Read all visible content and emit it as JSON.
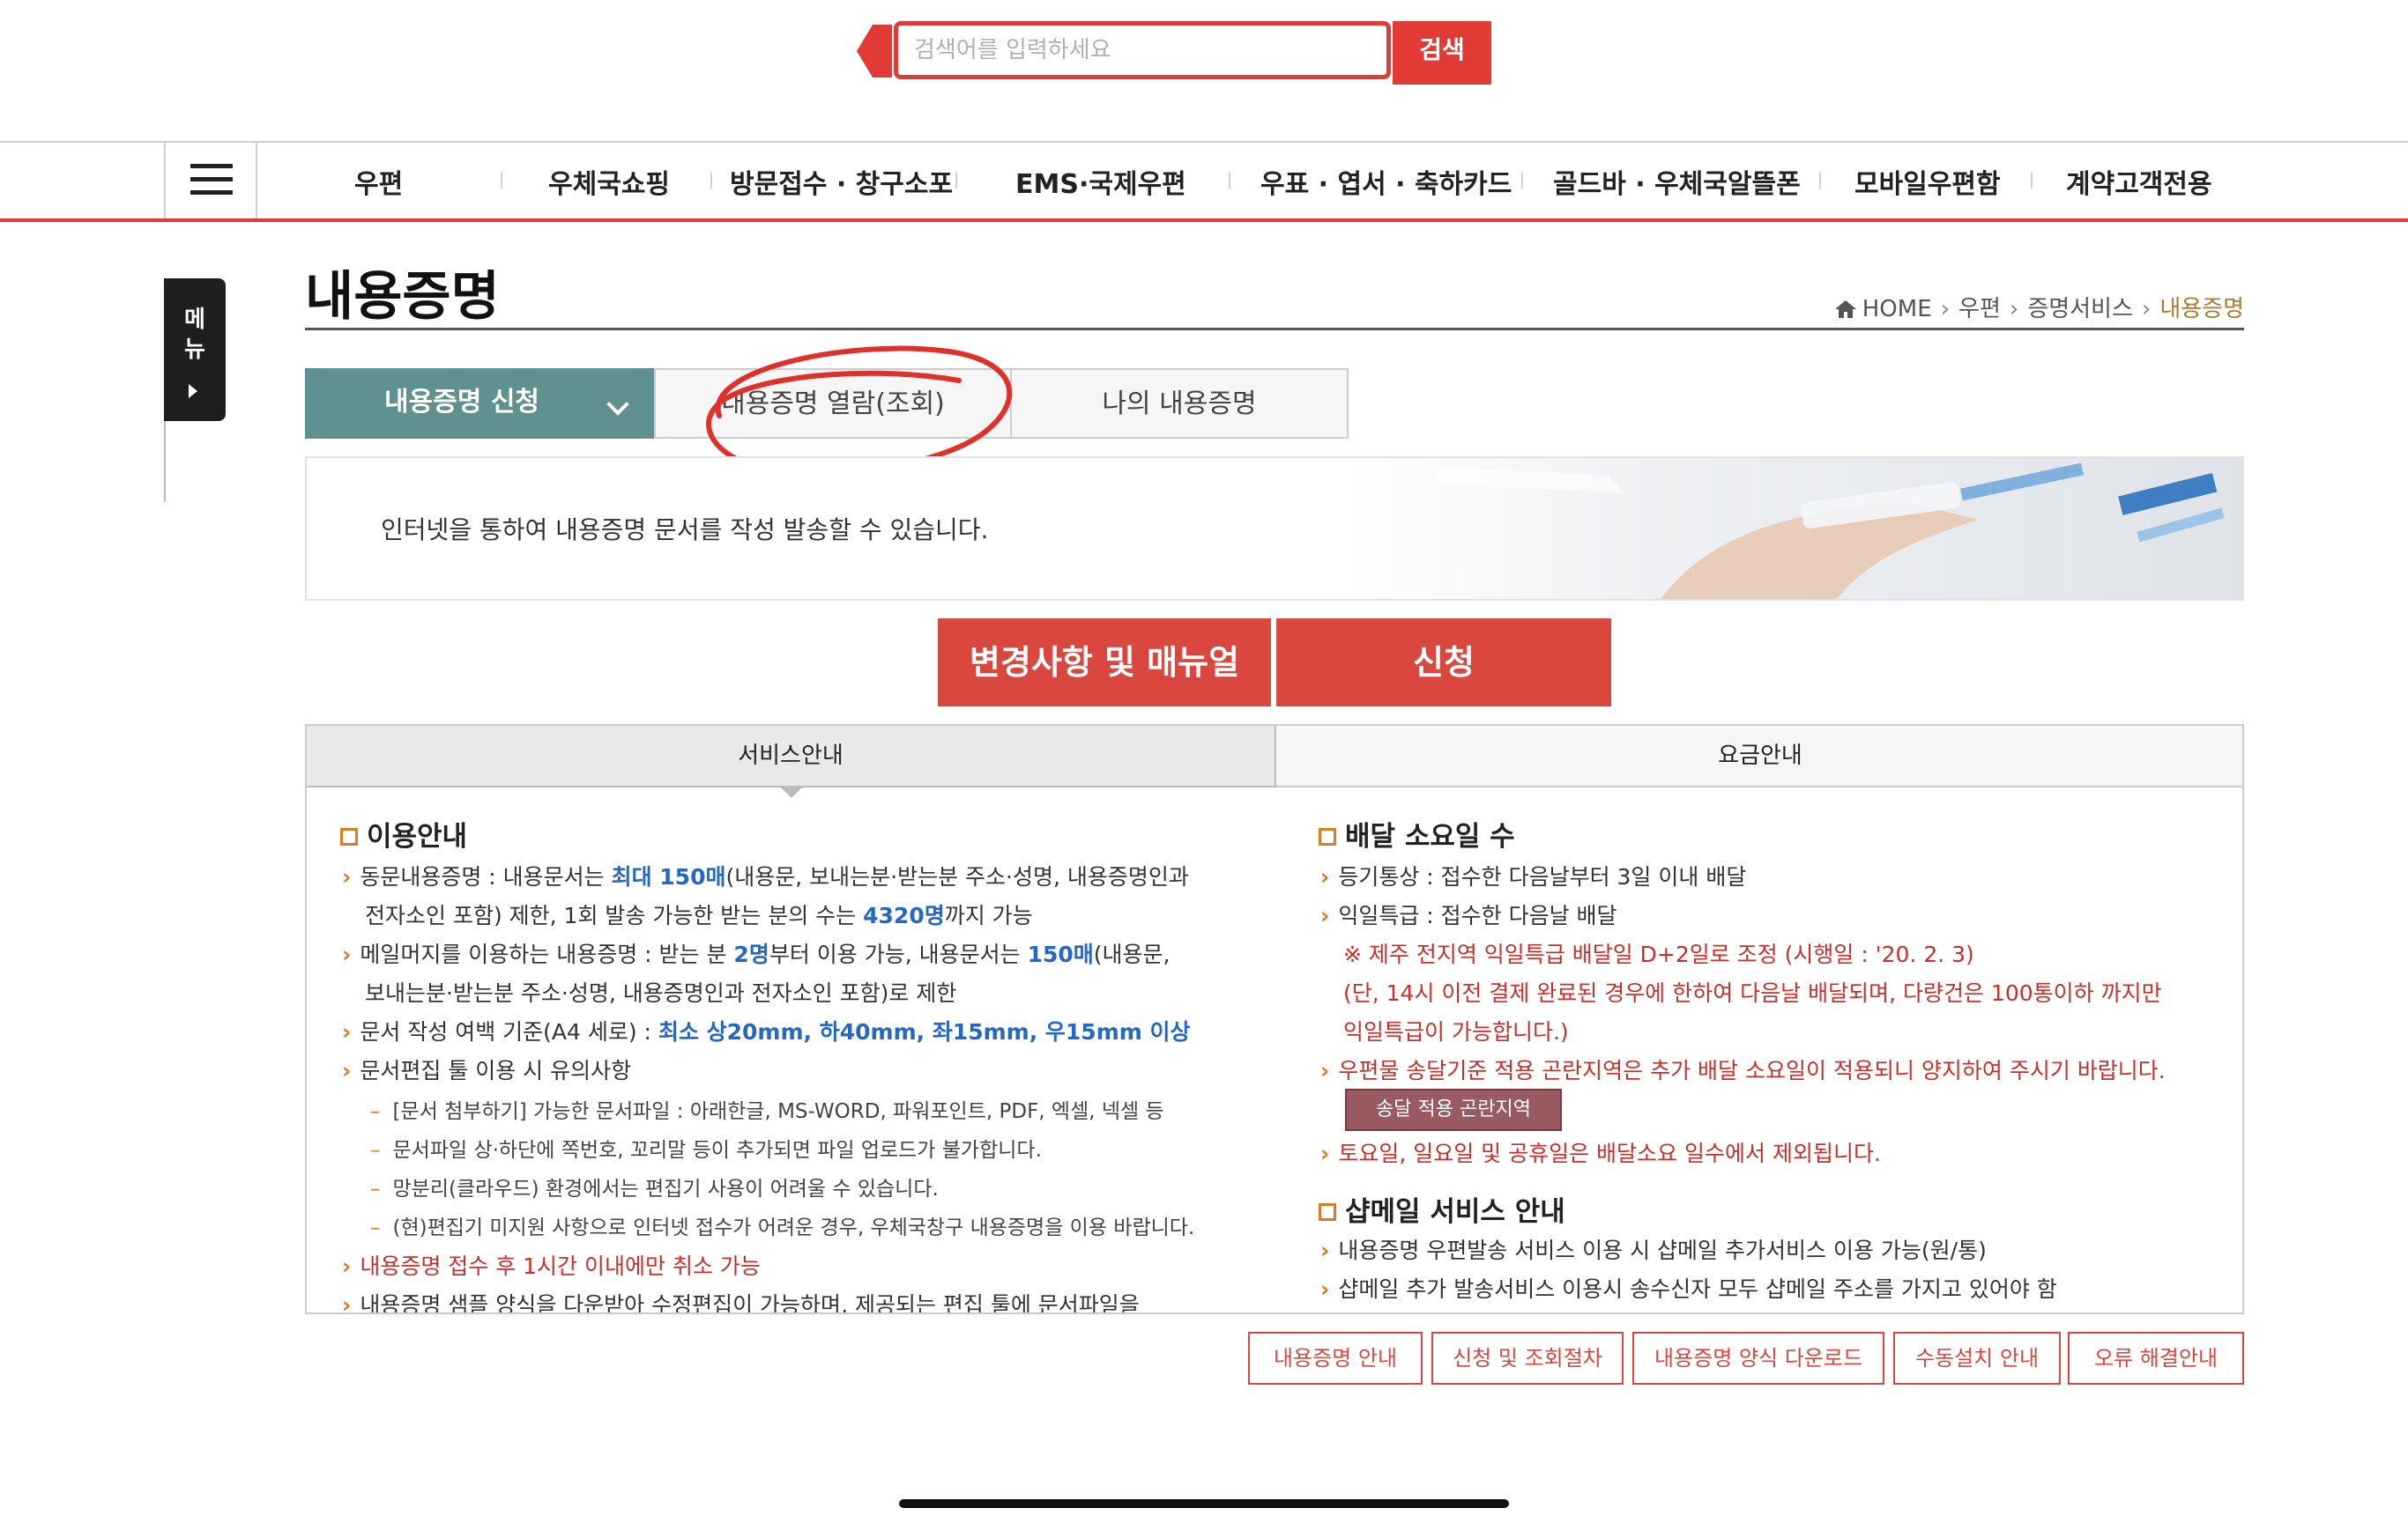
{
  "search": {
    "placeholder": "검색어를 입력하세요",
    "button_label": "검색"
  },
  "nav": {
    "items": [
      "우편",
      "우체국쇼핑",
      "방문접수 · 창구소포",
      "EMS·국제우편",
      "우표 · 엽서 · 축하카드",
      "골드바 · 우체국알뜰폰",
      "모바일우편함",
      "계약고객전용"
    ]
  },
  "side_menu": {
    "label": "메뉴"
  },
  "page": {
    "title": "내용증명"
  },
  "breadcrumb": {
    "home": "HOME",
    "level1": "우편",
    "level2": "증명서비스",
    "current": "내용증명"
  },
  "tabs": [
    "내용증명 신청",
    "내용증명 열람(조회)",
    "나의 내용증명"
  ],
  "banner": {
    "text": "인터넷을 통하여 내용증명 문서를 작성 발송할 수 있습니다."
  },
  "buttons": {
    "manual": "변경사항 및 매뉴얼",
    "apply": "신청"
  },
  "info_tabs": [
    "서비스안내",
    "요금안내"
  ],
  "usage": {
    "title": "이용안내",
    "l1a": "동문내용증명 : 내용문서는 ",
    "l1b": "최대 150매",
    "l1c": "(내용문, 보내는분·받는분 주소·성명, 내용증명인과",
    "l2a": "전자소인 포함) 제한, 1회 발송 가능한 받는 분의 수는 ",
    "l2b": "4320명",
    "l2c": "까지 가능",
    "l3a": "메일머지를 이용하는 내용증명 : 받는 분 ",
    "l3b": "2명",
    "l3c": "부터 이용 가능, 내용문서는 ",
    "l3d": "150매",
    "l3e": "(내용문,",
    "l4": "보내는분·받는분 주소·성명, 내용증명인과 전자소인 포함)로 제한",
    "l5a": "문서 작성 여백 기준(A4 세로) : ",
    "l5b": "최소 상20mm, 하40mm, 좌15mm, 우15mm 이상",
    "l6": "문서편집 툴 이용 시 유의사항",
    "d1": "[문서 첨부하기] 가능한 문서파일 : 아래한글, MS-WORD, 파워포인트, PDF, 엑셀, 넥셀 등",
    "d2": "문서파일 상·하단에 쪽번호, 꼬리말 등이 추가되면 파일 업로드가 불가합니다.",
    "d3": "망분리(클라우드) 환경에서는 편집기 사용이 어려울 수 있습니다.",
    "d4": "(현)편집기 미지원 사항으로 인터넷 접수가 어려운 경우, 우체국창구 내용증명을 이용 바랍니다.",
    "l7": "내용증명 접수 후 1시간 이내에만 취소 가능",
    "l8": "내용증명 샘플 양식을 다운받아 수정편집이 가능하며, 제공되는 편집 툴에 문서파일을"
  },
  "delivery": {
    "title": "배달 소요일 수",
    "l1": "등기통상 : 접수한 다음날부터 3일 이내 배달",
    "l2": "익일특급 : 접수한 다음날 배달",
    "n1": "※ 제주 전지역 익일특급 배달일 D+2일로 조정 (시행일 : '20. 2. 3)",
    "n2": "(단, 14시 이전 결제 완료된 경우에 한하여 다음날 배달되며, 다량건은 100통이하 까지만",
    "n3": "익일특급이 가능합니다.)",
    "l3": "우편물 송달기준 적용 곤란지역은 추가 배달 소요일이 적용되니 양지하여 주시기 바랍니다.",
    "zone_button": "송달 적용 곤란지역",
    "l4": "토요일, 일요일 및 공휴일은 배달소요 일수에서 제외됩니다."
  },
  "shopmail": {
    "title": "샵메일 서비스 안내",
    "l1": "내용증명 우편발송 서비스 이용 시 샵메일 추가서비스 이용 가능(원/통)",
    "l2": "샵메일 추가 발송서비스 이용시 송수신자 모두 샵메일 주소를 가지고 있어야 함"
  },
  "bottom_buttons": [
    "내용증명 안내",
    "신청 및 조회절차",
    "내용증명 양식 다운로드",
    "수동설치 안내",
    "오류 해결안내"
  ],
  "colors": {
    "accent_red": "#e23a34",
    "tab_teal": "#5f9191",
    "button_red": "#d9473f",
    "link_blue": "#2468c4"
  }
}
